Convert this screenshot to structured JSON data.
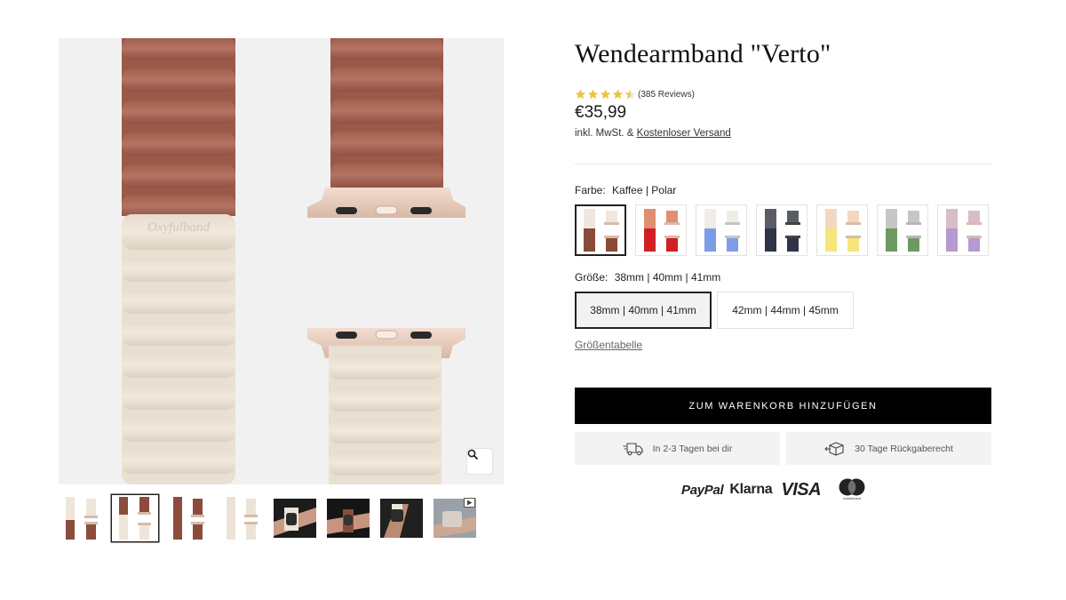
{
  "product": {
    "title": "Wendearmband \"Verto\"",
    "rating_value": 4.5,
    "rating_count": "(385 Reviews)",
    "price": "€35,99",
    "tax_note": "inkl. MwSt. &",
    "shipping_link": "Kostenloser Versand"
  },
  "color_option": {
    "label": "Farbe:",
    "selected": "Kaffee | Polar",
    "swatches": [
      {
        "name": "Kaffee | Polar",
        "top": "#efe7de",
        "bottom": "#8a4a3a"
      },
      {
        "name": "Rot",
        "top": "#e09070",
        "bottom": "#d01f24"
      },
      {
        "name": "Blau",
        "top": "#f0ece6",
        "bottom": "#7e9ce8"
      },
      {
        "name": "Navy",
        "top": "#5a5d66",
        "bottom": "#2e3346"
      },
      {
        "name": "Gelb",
        "top": "#f2d8c2",
        "bottom": "#f5e57a"
      },
      {
        "name": "Grün",
        "top": "#c4c6c8",
        "bottom": "#6e9a62"
      },
      {
        "name": "Lila",
        "top": "#d8bcc8",
        "bottom": "#b49ad0"
      }
    ]
  },
  "size_option": {
    "label": "Größe:",
    "selected": "38mm | 40mm | 41mm",
    "options": [
      "38mm | 40mm | 41mm",
      "42mm | 44mm | 45mm"
    ]
  },
  "size_chart_link": "Größentabelle",
  "cart_button": "ZUM WARENKORB HINZUFÜGEN",
  "benefits": {
    "delivery": "In 2-3 Tagen bei dir",
    "returns": "30 Tage Rückgaberecht"
  },
  "payments": {
    "paypal": "PayPal",
    "klarna": "Klarna",
    "visa": "VISA",
    "mastercard": "mastercard"
  },
  "gallery": {
    "embossed_logo": "Oxyfulband",
    "thumbnails": [
      "band-front",
      "band-pair-selected",
      "band-brown",
      "band-cream",
      "wrist-photo-1",
      "wrist-photo-2",
      "wrist-photo-3",
      "video"
    ]
  }
}
